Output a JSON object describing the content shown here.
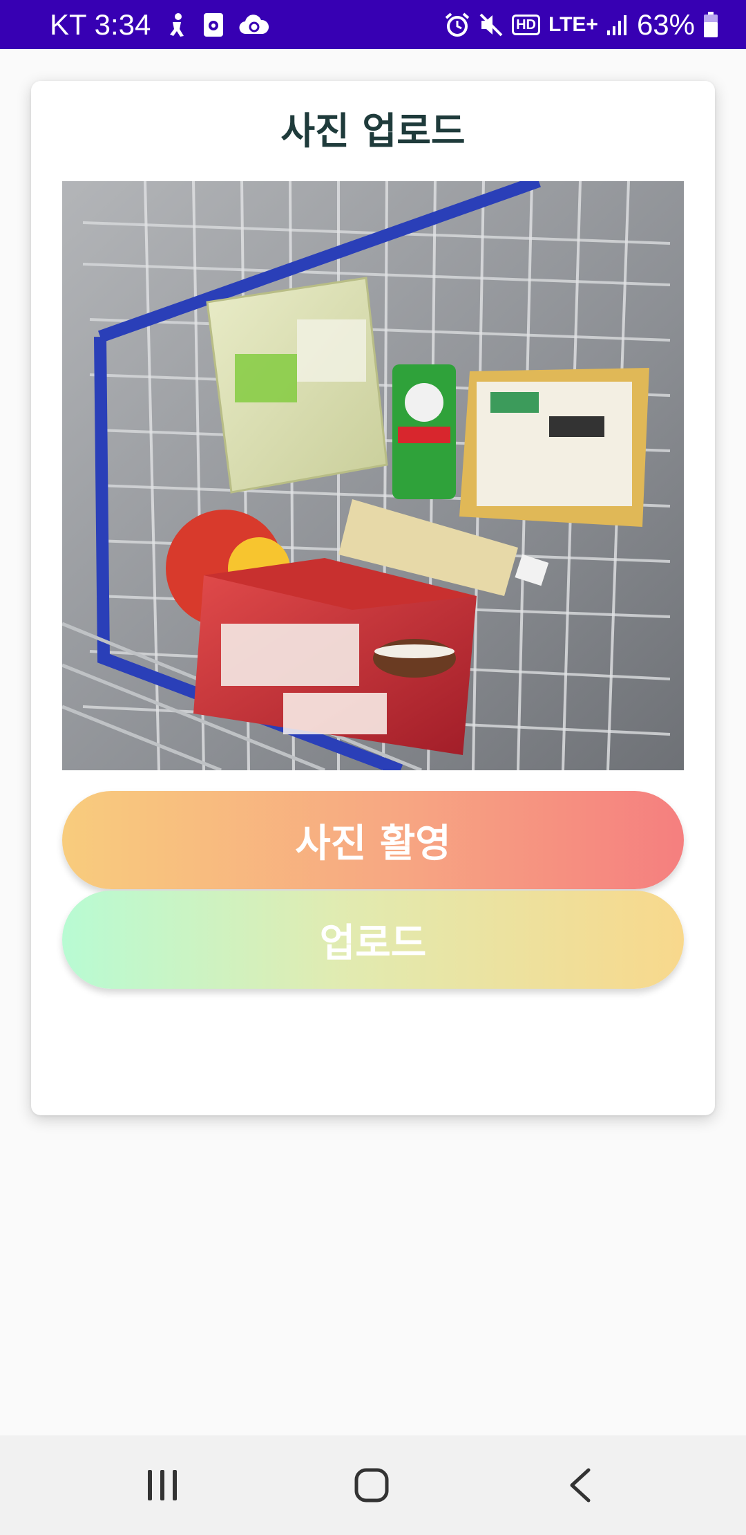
{
  "status_bar": {
    "carrier_time": "KT 3:34",
    "hd_label": "HD",
    "network_label": "LTE+",
    "battery_percent": "63%",
    "background_color": "#3700b3",
    "left_icons": [
      "accessibility-icon",
      "screen-record-icon",
      "cloud-sync-icon"
    ],
    "right_icons": [
      "alarm-icon",
      "mute-icon",
      "hd-voice-icon",
      "lte-icon",
      "signal-icon",
      "battery-icon"
    ]
  },
  "card": {
    "title": "사진 업로드",
    "photo_alt": "shopping-cart-groceries-photo"
  },
  "buttons": {
    "capture_label": "사진 활영",
    "upload_label": "업로드"
  },
  "colors": {
    "title_color": "#1f3b3b",
    "capture_gradient": [
      "#f8cc7d",
      "#f57f7f"
    ],
    "upload_gradient": [
      "#b8fbd3",
      "#f8d88c"
    ]
  },
  "nav_bar": {
    "items": [
      "recent-apps-icon",
      "home-icon",
      "back-icon"
    ]
  }
}
